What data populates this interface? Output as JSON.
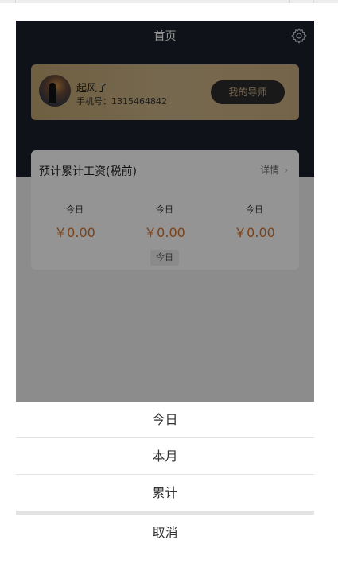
{
  "header": {
    "title": "首页",
    "settings_icon": "gear-icon"
  },
  "profile": {
    "name": "起风了",
    "phone_label": "手机号：",
    "phone": "1315464842",
    "mentor_button": "我的导师"
  },
  "salary": {
    "title": "预计累计工资(税前)",
    "detail_link": "详情",
    "stats": [
      {
        "label": "今日",
        "value": "￥0.00"
      },
      {
        "label": "今日",
        "value": "￥0.00"
      },
      {
        "label": "今日",
        "value": "￥0.00"
      }
    ],
    "range_chip": "今日"
  },
  "action_sheet": {
    "options": [
      "今日",
      "本月",
      "累计"
    ],
    "cancel": "取消"
  },
  "colors": {
    "header_bg": "#1b202c",
    "card_gold": "#c9ae80",
    "amount": "#d4732d",
    "mentor_button_bg": "#2b2b2e"
  }
}
